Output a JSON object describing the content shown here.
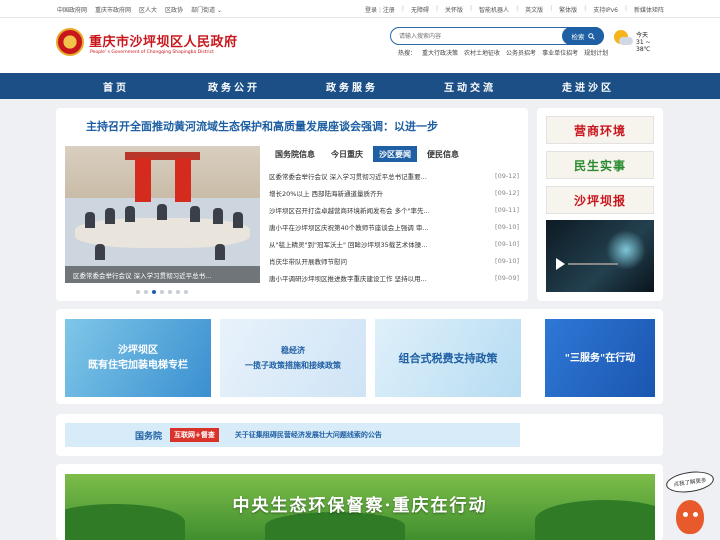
{
  "topbar": {
    "left_links": [
      "中国政府网",
      "重庆市政府网",
      "区人大",
      "区政协",
      "部门街道 ⌄"
    ],
    "right_links": [
      "登录",
      "注册",
      "无障碍",
      "关怀版",
      "智能机器人",
      "英文版",
      "繁体版",
      "支持IPv6",
      "新媒体矩阵"
    ]
  },
  "header": {
    "title": "重庆市沙坪坝区人民政府",
    "subtitle": "People' s Government of Chongqing Shapingba District",
    "search_placeholder": "请输入搜索内容",
    "search_button": "检索",
    "hot_label": "热搜：",
    "hot_terms": [
      "重大行政决策",
      "农村土地征收",
      "公务员招考",
      "事业单位招考",
      "规划计划"
    ],
    "weather_city": "今天",
    "weather_temp": "31 ~ 38℃"
  },
  "nav": [
    "首页",
    "政务公开",
    "政务服务",
    "互动交流",
    "走进沙区"
  ],
  "main": {
    "headline": "主持召开全面推动黄河流域生态保护和高质量发展座谈会强调：以进一步",
    "photo_caption": "区委常委会举行会议 深入学习贯彻习近平总书...",
    "dots_count": 7,
    "active_dot": 2,
    "tabs": [
      "国务院信息",
      "今日重庆",
      "沙区要闻",
      "便民信息"
    ],
    "active_tab": 2,
    "news": [
      {
        "title": "区委常委会举行会议 深入学习贯彻习近平总书记重要...",
        "date": "[09-12]"
      },
      {
        "title": "增长20%以上 西部陆海新通道量质齐升",
        "date": "[09-12]"
      },
      {
        "title": "沙坪坝区召开打造卓越营商环境新闻发布会 多个\"率先...",
        "date": "[09-11]"
      },
      {
        "title": "唐小平在沙坪坝区庆祝第40个教师节座谈会上强调 审...",
        "date": "[09-10]"
      },
      {
        "title": "从\"毯上精灵\"到\"冠军沃土\" 回眸沙坪坝35载艺术体操...",
        "date": "[09-10]"
      },
      {
        "title": "肖庆华带队开展教师节慰问",
        "date": "[09-10]"
      },
      {
        "title": "唐小平调研沙坪坝区推进数字重庆建设工作 坚持以用...",
        "date": "[09-09]"
      }
    ]
  },
  "side": {
    "buttons": [
      {
        "label": "营商环境",
        "color": "#c8161d"
      },
      {
        "label": "民生实事",
        "color": "#2a8a2e"
      },
      {
        "label": "沙坪坝报",
        "color": "#c8161d"
      }
    ]
  },
  "banners": [
    {
      "text": "沙坪坝区\n既有住宅加装电梯专栏",
      "color": "#ffffff"
    },
    {
      "text": "稳经济\n一揽子政策措施和接续政策",
      "color": "#1f5fa3"
    },
    {
      "text": "组合式税费支持政策",
      "color": "#1f5fa3"
    },
    {
      "text": "\"三服务\"在行动",
      "color": "#ffffff"
    }
  ],
  "notice": {
    "org": "国务院",
    "tag": "互联网+督查",
    "text": "关于征集阻碍民营经济发展壮大问题线索的公告"
  },
  "green_banner": {
    "slogan": "中央生态环保督察·重庆在行动"
  },
  "mascot": {
    "bubble": "点我了解更多"
  }
}
